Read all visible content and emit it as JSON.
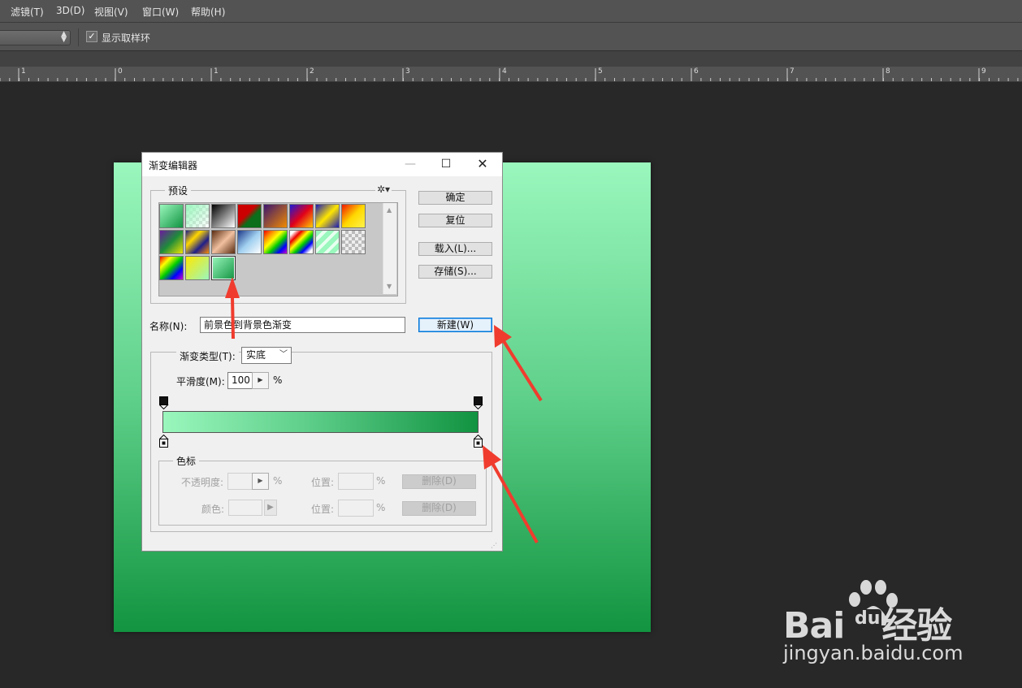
{
  "menubar": {
    "items": [
      {
        "label": "滤镜(T)"
      },
      {
        "label": "3D(D)"
      },
      {
        "label": "视图(V)"
      },
      {
        "label": "窗口(W)"
      },
      {
        "label": "帮助(H)"
      }
    ]
  },
  "options_bar": {
    "show_ring_checked": true,
    "show_ring_label": "显示取样环"
  },
  "ruler": {
    "labels": [
      "1",
      "0",
      "1",
      "2",
      "3",
      "4",
      "5",
      "6",
      "7",
      "8",
      "9"
    ]
  },
  "colors": {
    "gradient_start": "#9af7bd",
    "gradient_end": "#119341",
    "app_background": "#282828",
    "arrow": "#f03c2e"
  },
  "dialog": {
    "title": "渐变编辑器",
    "presets_label": "预设",
    "buttons": {
      "ok": "确定",
      "reset": "复位",
      "load": "载入(L)...",
      "save": "存储(S)...",
      "new": "新建(W)"
    },
    "name_label": "名称(N):",
    "name_value": "前景色到背景色渐变",
    "gradient_type_label": "渐变类型(T):",
    "gradient_type_value": "实底",
    "smoothness_label": "平滑度(M):",
    "smoothness_value": "100",
    "percent": "%",
    "stops_group_label": "色标",
    "opacity_label": "不透明度:",
    "location_label": "位置:",
    "delete_label": "删除(D)",
    "color_label": "颜色:"
  },
  "watermark": {
    "brand": "Bai",
    "brand_du": "du",
    "brand_suffix": "经验",
    "url": "jingyan.baidu.com"
  }
}
